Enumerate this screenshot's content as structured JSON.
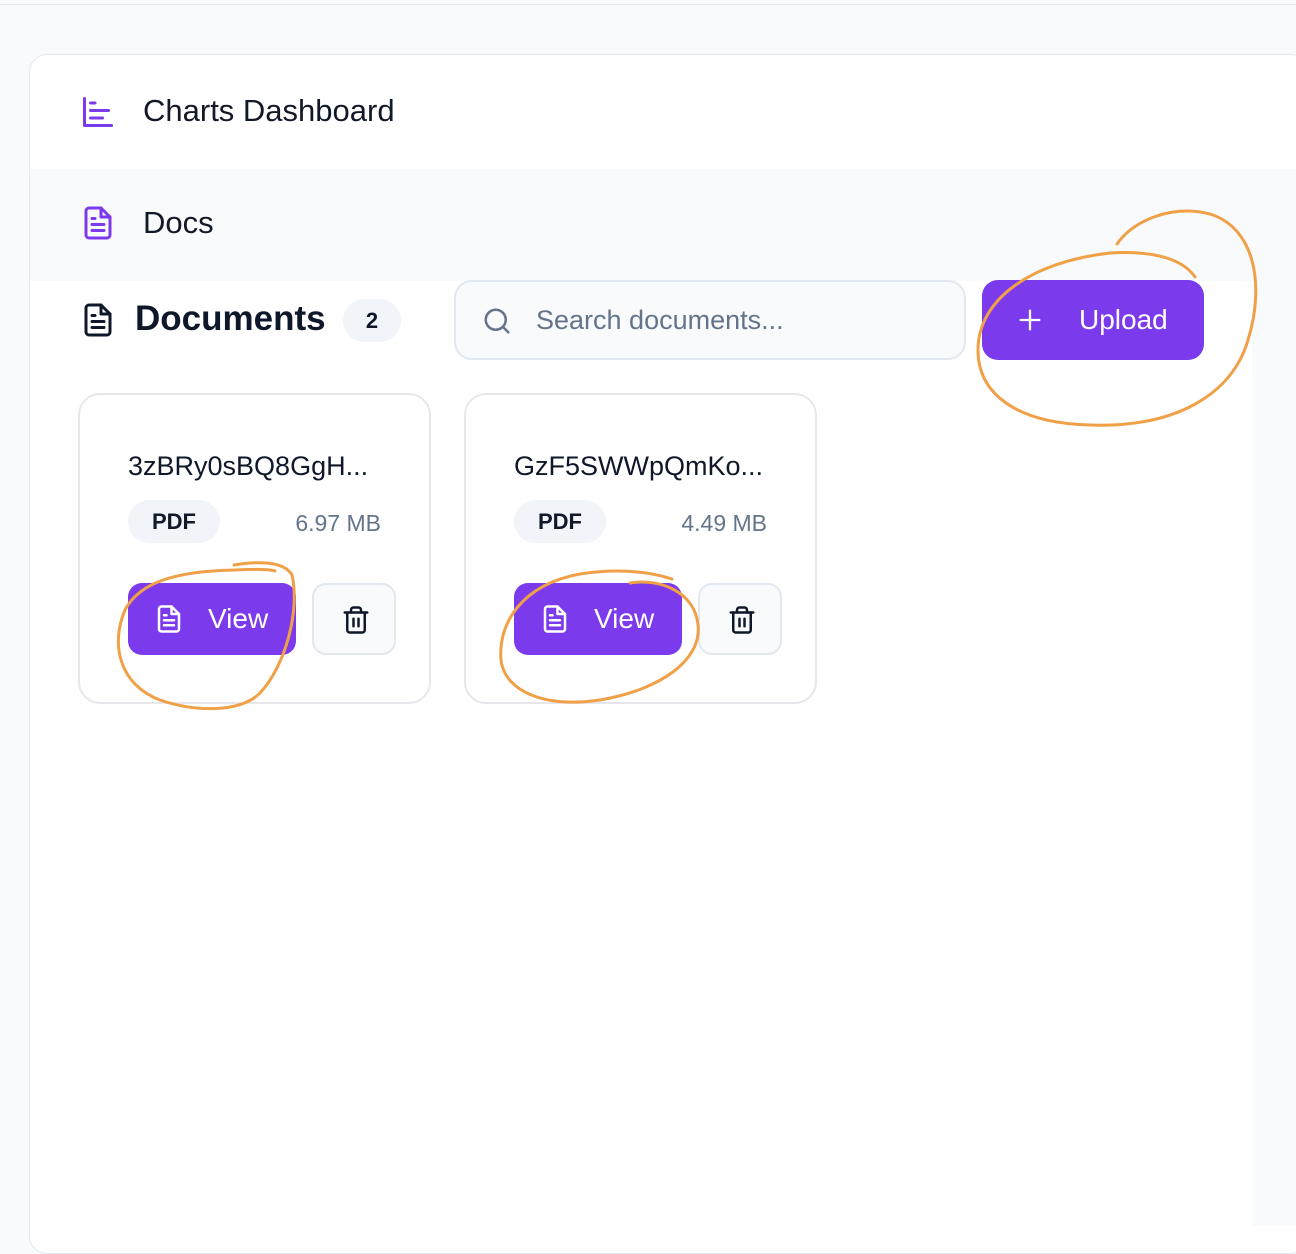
{
  "sidebar": {
    "items": [
      {
        "label": "Charts Dashboard",
        "icon": "bar-chart-icon"
      },
      {
        "label": "Docs",
        "icon": "document-icon"
      }
    ]
  },
  "documents": {
    "title": "Documents",
    "count": "2",
    "search_placeholder": "Search documents...",
    "upload_label": "Upload",
    "items": [
      {
        "name": "3zBRy0sBQ8GgH...",
        "type": "PDF",
        "size": "6.97 MB",
        "view_label": "View"
      },
      {
        "name": "GzF5SWWpQmKo...",
        "type": "PDF",
        "size": "4.49 MB",
        "view_label": "View"
      }
    ]
  },
  "colors": {
    "accent": "#7c3aed",
    "annotation": "#f0a047"
  }
}
